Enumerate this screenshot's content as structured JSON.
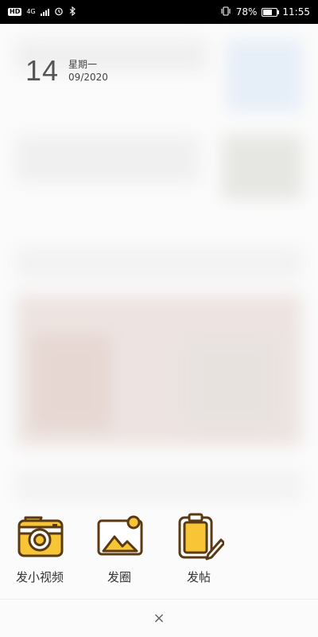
{
  "status_bar": {
    "badge_hd": "HD",
    "badge_4g": "4G",
    "battery": "78%",
    "battery_level": 0.78,
    "time": "11:55",
    "icons": [
      "alarm-icon",
      "bluetooth-icon",
      "vibrate-icon"
    ]
  },
  "date": {
    "day": "14",
    "weekday": "星期一",
    "month_year": "09/2020"
  },
  "actions": [
    {
      "label": "发小视频",
      "icon": "camera-icon"
    },
    {
      "label": "发圈",
      "icon": "picture-icon"
    },
    {
      "label": "发帖",
      "icon": "clipboard-pen-icon"
    }
  ],
  "close_label": "×",
  "colors": {
    "icon_outline": "#5a3a12",
    "icon_fill": "#f7c536",
    "text": "#333333"
  }
}
